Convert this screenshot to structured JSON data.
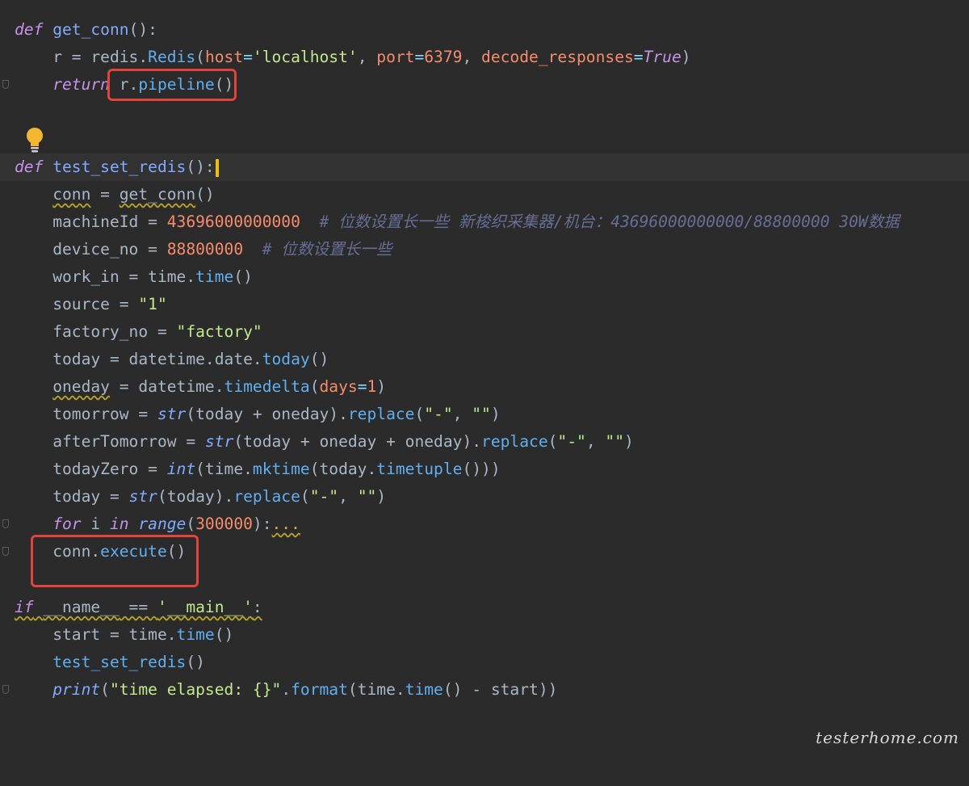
{
  "editor": {
    "lines": {
      "l1": {
        "def": "def",
        "name": "get_conn",
        "rest": "():"
      },
      "l2": {
        "a": "r = redis.",
        "cls": "Redis",
        "p1": "(",
        "host": "host",
        "eq1": "=",
        "s1": "'localhost'",
        "c1": ", ",
        "port": "port",
        "eq2": "=",
        "n1": "6379",
        "c2": ", ",
        "dec": "decode_responses",
        "eq3": "=",
        "b1": "True",
        "p2": ")"
      },
      "l3": {
        "ret": "return",
        "a": " r.",
        "fn": "pipeline",
        "b": "()"
      },
      "l5": {
        "def": "def",
        "name": "test_set_redis",
        "rest": "():"
      },
      "l6": {
        "a": "conn",
        "b": " = ",
        "fn": "get_conn",
        "c": "()"
      },
      "l7": {
        "a": "machineId = ",
        "n": "43696000000000",
        "cmt": "  # 位数设置长一些 新梭织采集器/机台：43696000000000/88800000 30W数据"
      },
      "l8": {
        "a": "device_no = ",
        "n": "88800000",
        "cmt": "  # 位数设置长一些"
      },
      "l9": {
        "a": "work_in = time.",
        "fn": "time",
        "b": "()"
      },
      "l10": {
        "a": "source = ",
        "s": "\"1\""
      },
      "l11": {
        "a": "factory_no = ",
        "s": "\"factory\""
      },
      "l12": {
        "a": "today = datetime.date.",
        "fn": "today",
        "b": "()"
      },
      "l13": {
        "a": "oneday",
        "b": " = datetime.",
        "fn": "timedelta",
        "p1": "(",
        "prm": "days",
        "eq": "=",
        "n": "1",
        "p2": ")"
      },
      "l14": {
        "a": "tomorrow = ",
        "bi": "str",
        "b": "(today + oneday).",
        "fn": "replace",
        "p1": "(",
        "s1": "\"-\"",
        "c": ", ",
        "s2": "\"\"",
        "p2": ")"
      },
      "l15": {
        "a": "afterTomorrow = ",
        "bi": "str",
        "b": "(today + oneday + oneday).",
        "fn": "replace",
        "p1": "(",
        "s1": "\"-\"",
        "c": ", ",
        "s2": "\"\"",
        "p2": ")"
      },
      "l16": {
        "a": "todayZero = ",
        "bi": "int",
        "b": "(time.",
        "fn1": "mktime",
        "c": "(today.",
        "fn2": "timetuple",
        "d": "()))"
      },
      "l17": {
        "a": "today = ",
        "bi": "str",
        "b": "(today).",
        "fn": "replace",
        "p1": "(",
        "s1": "\"-\"",
        "c": ", ",
        "s2": "\"\"",
        "p2": ")"
      },
      "l18": {
        "for": "for",
        "a": " i ",
        "in": "in",
        "sp": " ",
        "bi": "range",
        "p1": "(",
        "n": "300000",
        "p2": "):",
        "dots": "..."
      },
      "l19": {
        "a": "conn.",
        "fn": "execute",
        "b": "()"
      },
      "l21": {
        "if": "if",
        "a": " ",
        "nm": "__name__",
        "b": " == ",
        "s": "'__main__'",
        "c": ":"
      },
      "l22": {
        "a": "start = time.",
        "fn": "time",
        "b": "()"
      },
      "l23": {
        "fn": "test_set_redis",
        "b": "()"
      },
      "l24": {
        "bi": "print",
        "p1": "(",
        "s": "\"time elapsed: {}\"",
        "a": ".",
        "fn1": "format",
        "b": "(time.",
        "fn2": "time",
        "c": "() - start))"
      }
    }
  },
  "watermark": "testerhome.com",
  "colors": {
    "background": "#2b2b2b",
    "highlight": "#e0443a",
    "caret": "#f0c000"
  },
  "icons": {
    "bulb": "lightbulb-icon"
  }
}
